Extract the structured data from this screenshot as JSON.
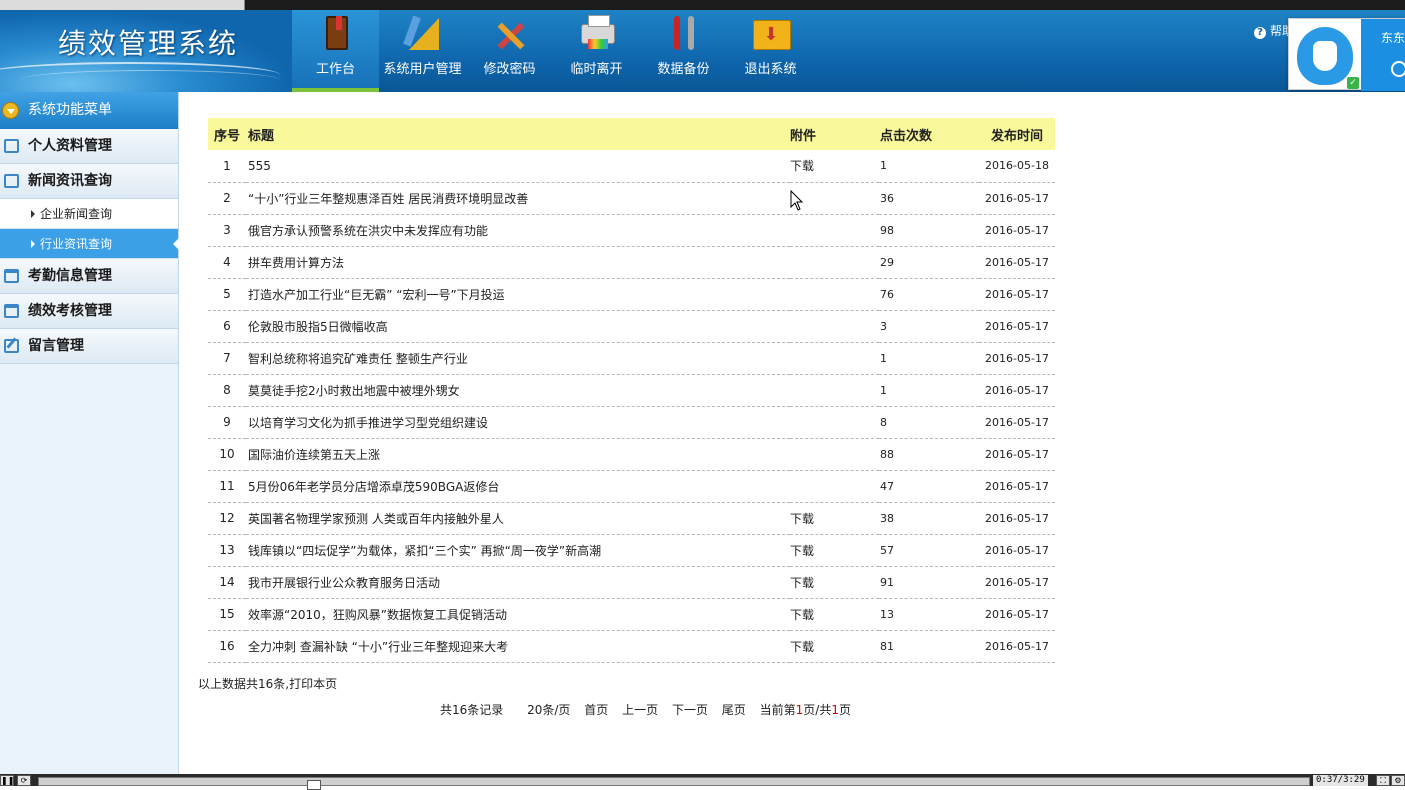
{
  "app": {
    "title": "绩效管理系统"
  },
  "nav": [
    {
      "label": "工作台",
      "icon": "book-icon",
      "active": true
    },
    {
      "label": "系统用户管理",
      "icon": "ruler-icon"
    },
    {
      "label": "修改密码",
      "icon": "tools-icon"
    },
    {
      "label": "临时离开",
      "icon": "printer-icon"
    },
    {
      "label": "数据备份",
      "icon": "wrench-icon"
    },
    {
      "label": "退出系统",
      "icon": "folder-download-icon"
    }
  ],
  "help": {
    "label": "帮助"
  },
  "widget": {
    "name": "东东"
  },
  "sidebar": {
    "header": "系统功能菜单",
    "items": [
      {
        "label": "个人资料管理"
      },
      {
        "label": "新闻资讯查询",
        "children": [
          {
            "label": "企业新闻查询"
          },
          {
            "label": "行业资讯查询",
            "active": true
          }
        ]
      },
      {
        "label": "考勤信息管理"
      },
      {
        "label": "绩效考核管理"
      },
      {
        "label": "留言管理"
      }
    ]
  },
  "table": {
    "headers": {
      "no": "序号",
      "title": "标题",
      "attachment": "附件",
      "hits": "点击次数",
      "date": "发布时间"
    },
    "rows": [
      {
        "no": "1",
        "title": "555",
        "attachment": "下载",
        "hits": "1",
        "date": "2016-05-18"
      },
      {
        "no": "2",
        "title": "“十小”行业三年整规惠泽百姓 居民消费环境明显改善",
        "attachment": "",
        "hits": "36",
        "date": "2016-05-17"
      },
      {
        "no": "3",
        "title": "俄官方承认预警系统在洪灾中未发挥应有功能",
        "attachment": "",
        "hits": "98",
        "date": "2016-05-17"
      },
      {
        "no": "4",
        "title": "拼车费用计算方法",
        "attachment": "",
        "hits": "29",
        "date": "2016-05-17"
      },
      {
        "no": "5",
        "title": "打造水产加工行业“巨无霸” “宏利一号”下月投运",
        "attachment": "",
        "hits": "76",
        "date": "2016-05-17"
      },
      {
        "no": "6",
        "title": "伦敦股市股指5日微幅收高",
        "attachment": "",
        "hits": "3",
        "date": "2016-05-17"
      },
      {
        "no": "7",
        "title": "智利总统称将追究矿难责任 整顿生产行业",
        "attachment": "",
        "hits": "1",
        "date": "2016-05-17"
      },
      {
        "no": "8",
        "title": "莫莫徒手挖2小时救出地震中被埋外甥女",
        "attachment": "",
        "hits": "1",
        "date": "2016-05-17"
      },
      {
        "no": "9",
        "title": "以培育学习文化为抓手推进学习型党组织建设",
        "attachment": "",
        "hits": "8",
        "date": "2016-05-17"
      },
      {
        "no": "10",
        "title": "国际油价连续第五天上涨",
        "attachment": "",
        "hits": "88",
        "date": "2016-05-17"
      },
      {
        "no": "11",
        "title": "5月份06年老学员分店增添卓茂590BGA返修台",
        "attachment": "",
        "hits": "47",
        "date": "2016-05-17"
      },
      {
        "no": "12",
        "title": "英国著名物理学家预测 人类或百年内接触外星人",
        "attachment": "下载",
        "hits": "38",
        "date": "2016-05-17"
      },
      {
        "no": "13",
        "title": "钱库镇以“四坛促学”为载体，紧扣“三个实” 再掀“周一夜学”新高潮",
        "attachment": "下载",
        "hits": "57",
        "date": "2016-05-17"
      },
      {
        "no": "14",
        "title": "我市开展银行业公众教育服务日活动",
        "attachment": "下载",
        "hits": "91",
        "date": "2016-05-17"
      },
      {
        "no": "15",
        "title": "效率源“2010，狂购风暴”数据恢复工具促销活动",
        "attachment": "下载",
        "hits": "13",
        "date": "2016-05-17"
      },
      {
        "no": "16",
        "title": "全力冲刺 查漏补缺 “十小”行业三年整规迎来大考",
        "attachment": "下载",
        "hits": "81",
        "date": "2016-05-17"
      }
    ]
  },
  "summary": {
    "text": "以上数据共16条,",
    "print_link": "打印本页"
  },
  "pager": {
    "total": "共16条记录",
    "per_page": "20条/页",
    "first": "首页",
    "prev": "上一页",
    "next": "下一页",
    "last": "尾页",
    "current_prefix": "当前第",
    "current_page": "1",
    "of": "页/共",
    "total_pages": "1",
    "suffix": "页"
  },
  "player": {
    "time": "0:37/3:29"
  },
  "colors": {
    "header_blue": "#0d62a8",
    "table_header": "#f9f99b",
    "active_sub": "#3ba0e5",
    "nav_active_bar": "#7dc43a"
  }
}
